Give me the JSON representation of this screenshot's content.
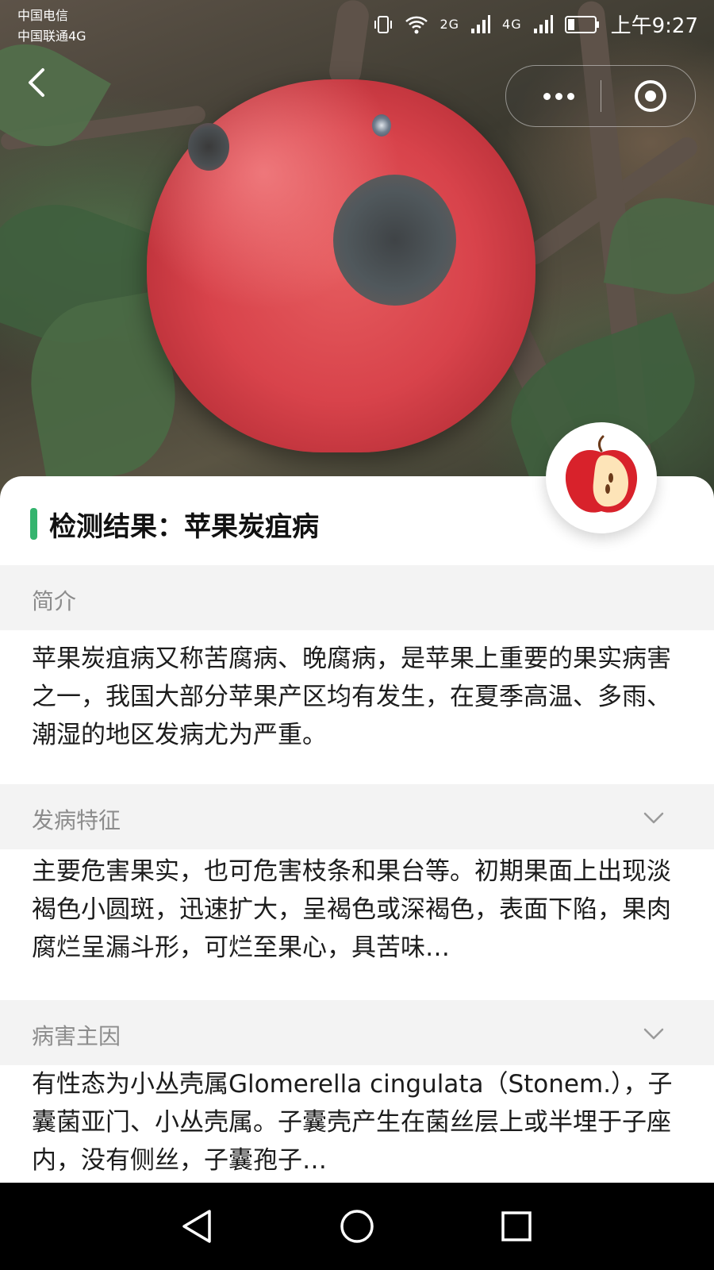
{
  "status_bar": {
    "carrier_1": "中国电信",
    "carrier_2": "中国联通4G",
    "network_1": "2G",
    "network_2": "4G",
    "time": "上午9:27"
  },
  "hero": {
    "image_icon": "photo-of-diseased-apple"
  },
  "result": {
    "title": "检测结果：苹果炭疽病",
    "accent_color": "#34b46e"
  },
  "sections": [
    {
      "heading": "简介",
      "body": "苹果炭疽病又称苦腐病、晚腐病，是苹果上重要的果实病害之一，我国大部分苹果产区均有发生，在夏季高温、多雨、潮湿的地区发病尤为严重。",
      "collapsible": false
    },
    {
      "heading": "发病特征",
      "body": "主要危害果实，也可危害枝条和果台等。初期果面上出现淡褐色小圆斑，迅速扩大，呈褐色或深褐色，表面下陷，果肉腐烂呈漏斗形，可烂至果心，具苦味…",
      "collapsible": true
    },
    {
      "heading": "病害主因",
      "body": "有性态为小丛壳属Glomerella cingulata（Stonem.），子囊菌亚门、小丛壳属。子囊壳产生在菌丝层上或半埋于子座内，没有侧丝，子囊孢子…",
      "collapsible": true
    }
  ]
}
